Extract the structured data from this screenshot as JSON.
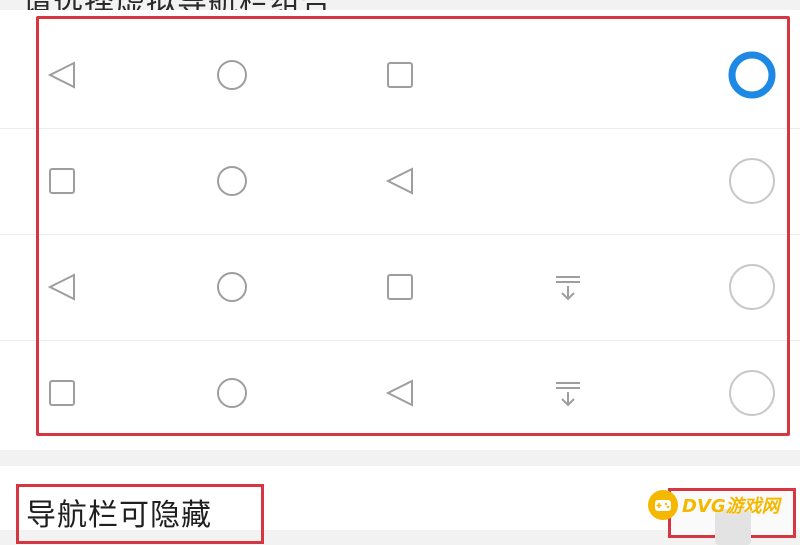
{
  "section": {
    "title": "请选择虚拟导航栏组合"
  },
  "combos": [
    {
      "icons": [
        "back-icon",
        "home-icon",
        "recents-icon"
      ],
      "selected": true
    },
    {
      "icons": [
        "recents-icon",
        "home-icon",
        "back-icon"
      ],
      "selected": false
    },
    {
      "icons": [
        "back-icon",
        "home-icon",
        "recents-icon",
        "pull-notification-icon"
      ],
      "selected": false
    },
    {
      "icons": [
        "recents-icon",
        "home-icon",
        "back-icon",
        "pull-notification-icon"
      ],
      "selected": false
    }
  ],
  "hide_navbar": {
    "label": "导航栏可隐藏",
    "enabled": false
  },
  "watermark": {
    "text": "DVG游戏网"
  },
  "colors": {
    "accent": "#1e88e5",
    "highlight": "#d6363f",
    "icon": "#9e9e9e"
  }
}
